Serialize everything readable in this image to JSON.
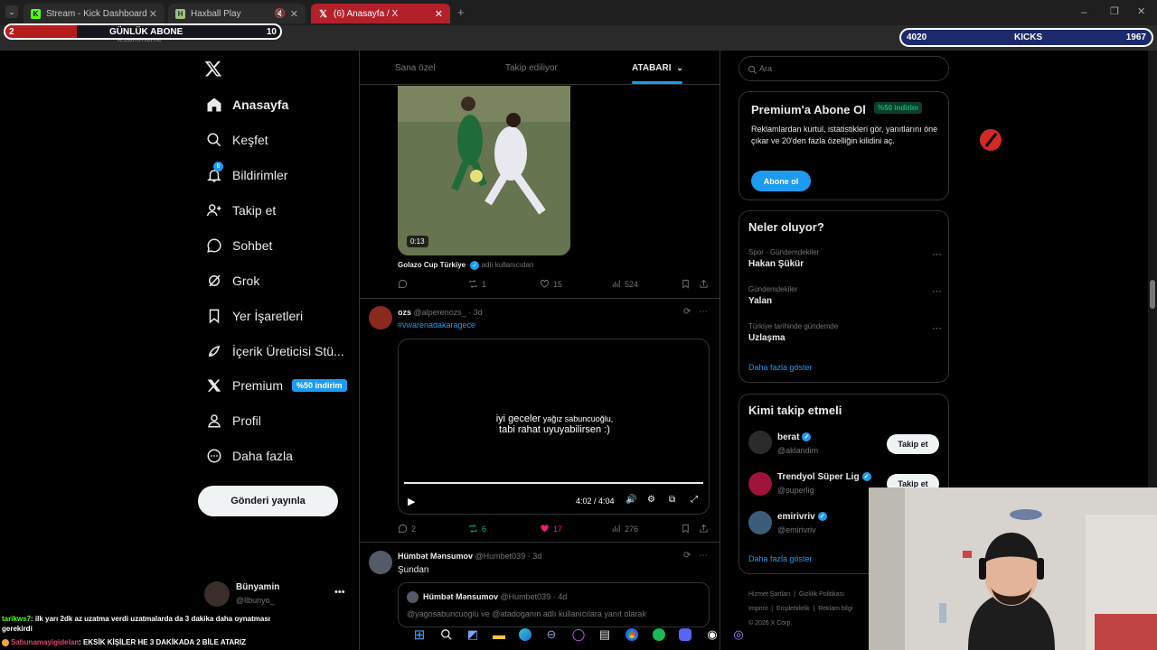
{
  "browser": {
    "tabs": [
      {
        "title": "Stream - Kick Dashboard"
      },
      {
        "title": "Haxball Play"
      },
      {
        "title": "(6) Anasayfa / X"
      }
    ],
    "url": "x.com/home"
  },
  "overlay": {
    "left_counter": {
      "left_value": "2",
      "label": "GÜNLÜK ABONE",
      "right_value": "10"
    },
    "right_counter": {
      "left_value": "4020",
      "label": "KICKS",
      "right_value": "1967"
    }
  },
  "sidebar": {
    "items": [
      {
        "label": "Anasayfa",
        "icon": "home-icon"
      },
      {
        "label": "Keşfet",
        "icon": "search-icon"
      },
      {
        "label": "Bildirimler",
        "icon": "bell-icon",
        "badge": "6"
      },
      {
        "label": "Takip et",
        "icon": "follow-icon"
      },
      {
        "label": "Sohbet",
        "icon": "chat-icon"
      },
      {
        "label": "Grok",
        "icon": "grok-icon"
      },
      {
        "label": "Yer İşaretleri",
        "icon": "bookmark-icon"
      },
      {
        "label": "İçerik Üreticisi Stü...",
        "icon": "rocket-icon"
      },
      {
        "label": "Premium",
        "icon": "x-logo-icon",
        "badge": "%50 indirim"
      },
      {
        "label": "Profil",
        "icon": "person-icon"
      },
      {
        "label": "Daha fazla",
        "icon": "more-circle-icon"
      }
    ],
    "post_button": "Gönderi yayınla",
    "account": {
      "name": "Bünyamin",
      "handle": "@llbunyo_"
    }
  },
  "timeline": {
    "tabs": [
      "Sana özel",
      "Takip ediliyor",
      "ATABARI"
    ],
    "posts": [
      {
        "video_time": "0:13",
        "attribution": "Golazo Cup Türkiye",
        "attribution_suffix": "adlı kullanıcıdan",
        "stats": {
          "replies": "",
          "reposts": "1",
          "likes": "15",
          "views": "524"
        }
      },
      {
        "author": "ozs",
        "handle": "@alperenozs_",
        "age": "3d",
        "text": "#vwarenadakaragece",
        "video_caption_line1_bold": "iyi geceler",
        "video_caption_line1_rest": " yağız sabuncuoğlu,",
        "video_caption_line2": "tabi rahat uyuyabilirsen :)",
        "video_time": "4:02 / 4:04",
        "stats": {
          "replies": "2",
          "reposts": "6",
          "likes": "17",
          "views": "276"
        }
      },
      {
        "author": "Hümbət Mənsumov",
        "handle": "@Humbet039",
        "age": "3d",
        "text": "Şundan",
        "quote": {
          "author": "Hümbət Mənsumov",
          "handle": "@Humbet039",
          "age": "4d",
          "text": "@yagosabuncuoglu ve @atadoganın adlı kullanıcılara yanıt olarak"
        }
      }
    ]
  },
  "right": {
    "search_placeholder": "Ara",
    "premium": {
      "title": "Premium'a Abone Ol",
      "badge": "%50 indirim",
      "text": "Reklamlardan kurtul, istatistikleri gör, yanıtlarını öne çıkar ve 20'den fazla özelliğin kilidini aç.",
      "button": "Abone ol"
    },
    "trends": {
      "title": "Neler oluyor?",
      "items": [
        {
          "meta": "Spor · Gündemdekiler",
          "name": "Hakan Şükür"
        },
        {
          "meta": "Gündemdekiler",
          "name": "Yalan"
        },
        {
          "meta": "Türkiye tarihinde gündemde",
          "name": "Uzlaşma"
        }
      ],
      "more": "Daha fazla göster"
    },
    "who_to_follow": {
      "title": "Kimi takip etmeli",
      "items": [
        {
          "name": "berat",
          "handle": "@aklandim",
          "button": "Takip et"
        },
        {
          "name": "Trendyol Süper Lig",
          "handle": "@superlig",
          "button": "Takip et"
        },
        {
          "name": "emirivriv",
          "handle": "@emirivriv",
          "button": ""
        }
      ],
      "more": "Daha fazla göster"
    },
    "footer": [
      "Hizmet Şartları",
      "Gizlilik Politikası",
      "Imprint",
      "Erişilebilirlik",
      "Reklam bilgi",
      "© 2026 X Corp."
    ]
  },
  "chat": [
    {
      "user": "tarikws7",
      "message": ": ilk yarı 2dk az uzatma verdi uzatmalarda da 3 dakika daha oynatması gerekirdi"
    },
    {
      "user": "Sabunamayigidelan",
      "message": ": EKSİK KİŞİLER HE 3 DAKİKADA 2 BİLE ATARIZ"
    }
  ],
  "colors": {
    "accent": "#1d9bf0",
    "like": "#f91880",
    "repost": "#00ba7c",
    "badge_bg": "#1d9bf0"
  }
}
